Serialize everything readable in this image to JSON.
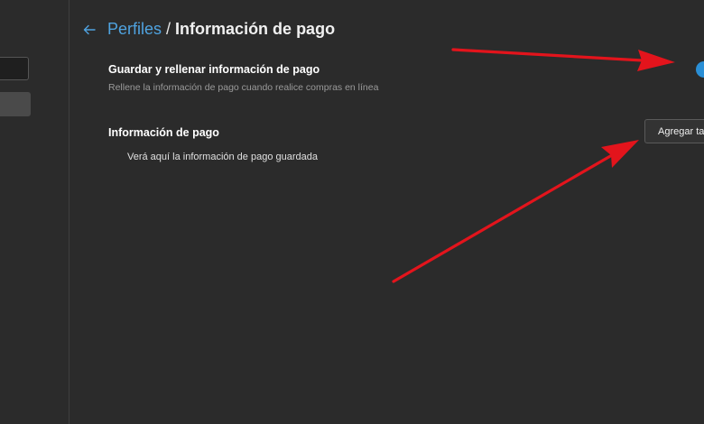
{
  "header": {
    "parent_link": "Perfiles",
    "separator": "/",
    "current_page": "Información de pago"
  },
  "save_setting": {
    "title": "Guardar y rellenar información de pago",
    "description": "Rellene la información de pago cuando realice compras en línea",
    "enabled": true
  },
  "payment_section": {
    "title": "Información de pago",
    "add_button_label": "Agregar tarjeta",
    "empty_message": "Verá aquí la información de pago guardada"
  },
  "colors": {
    "background": "#2b2b2b",
    "accent": "#4fa3e0",
    "toggle_on": "#2a8fd6",
    "annotation_arrow": "#e3141c"
  },
  "icons": {
    "back": "arrow-left-icon"
  }
}
